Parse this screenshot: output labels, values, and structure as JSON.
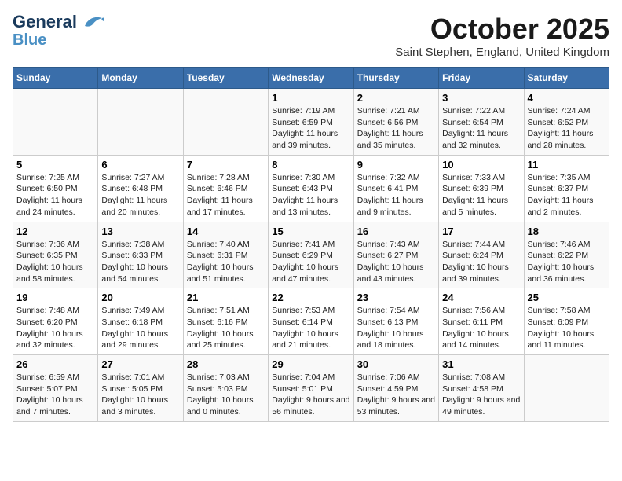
{
  "header": {
    "logo_line1": "General",
    "logo_line2": "Blue",
    "month": "October 2025",
    "location": "Saint Stephen, England, United Kingdom"
  },
  "weekdays": [
    "Sunday",
    "Monday",
    "Tuesday",
    "Wednesday",
    "Thursday",
    "Friday",
    "Saturday"
  ],
  "weeks": [
    [
      {
        "num": "",
        "info": ""
      },
      {
        "num": "",
        "info": ""
      },
      {
        "num": "",
        "info": ""
      },
      {
        "num": "1",
        "info": "Sunrise: 7:19 AM\nSunset: 6:59 PM\nDaylight: 11 hours and 39 minutes."
      },
      {
        "num": "2",
        "info": "Sunrise: 7:21 AM\nSunset: 6:56 PM\nDaylight: 11 hours and 35 minutes."
      },
      {
        "num": "3",
        "info": "Sunrise: 7:22 AM\nSunset: 6:54 PM\nDaylight: 11 hours and 32 minutes."
      },
      {
        "num": "4",
        "info": "Sunrise: 7:24 AM\nSunset: 6:52 PM\nDaylight: 11 hours and 28 minutes."
      }
    ],
    [
      {
        "num": "5",
        "info": "Sunrise: 7:25 AM\nSunset: 6:50 PM\nDaylight: 11 hours and 24 minutes."
      },
      {
        "num": "6",
        "info": "Sunrise: 7:27 AM\nSunset: 6:48 PM\nDaylight: 11 hours and 20 minutes."
      },
      {
        "num": "7",
        "info": "Sunrise: 7:28 AM\nSunset: 6:46 PM\nDaylight: 11 hours and 17 minutes."
      },
      {
        "num": "8",
        "info": "Sunrise: 7:30 AM\nSunset: 6:43 PM\nDaylight: 11 hours and 13 minutes."
      },
      {
        "num": "9",
        "info": "Sunrise: 7:32 AM\nSunset: 6:41 PM\nDaylight: 11 hours and 9 minutes."
      },
      {
        "num": "10",
        "info": "Sunrise: 7:33 AM\nSunset: 6:39 PM\nDaylight: 11 hours and 5 minutes."
      },
      {
        "num": "11",
        "info": "Sunrise: 7:35 AM\nSunset: 6:37 PM\nDaylight: 11 hours and 2 minutes."
      }
    ],
    [
      {
        "num": "12",
        "info": "Sunrise: 7:36 AM\nSunset: 6:35 PM\nDaylight: 10 hours and 58 minutes."
      },
      {
        "num": "13",
        "info": "Sunrise: 7:38 AM\nSunset: 6:33 PM\nDaylight: 10 hours and 54 minutes."
      },
      {
        "num": "14",
        "info": "Sunrise: 7:40 AM\nSunset: 6:31 PM\nDaylight: 10 hours and 51 minutes."
      },
      {
        "num": "15",
        "info": "Sunrise: 7:41 AM\nSunset: 6:29 PM\nDaylight: 10 hours and 47 minutes."
      },
      {
        "num": "16",
        "info": "Sunrise: 7:43 AM\nSunset: 6:27 PM\nDaylight: 10 hours and 43 minutes."
      },
      {
        "num": "17",
        "info": "Sunrise: 7:44 AM\nSunset: 6:24 PM\nDaylight: 10 hours and 39 minutes."
      },
      {
        "num": "18",
        "info": "Sunrise: 7:46 AM\nSunset: 6:22 PM\nDaylight: 10 hours and 36 minutes."
      }
    ],
    [
      {
        "num": "19",
        "info": "Sunrise: 7:48 AM\nSunset: 6:20 PM\nDaylight: 10 hours and 32 minutes."
      },
      {
        "num": "20",
        "info": "Sunrise: 7:49 AM\nSunset: 6:18 PM\nDaylight: 10 hours and 29 minutes."
      },
      {
        "num": "21",
        "info": "Sunrise: 7:51 AM\nSunset: 6:16 PM\nDaylight: 10 hours and 25 minutes."
      },
      {
        "num": "22",
        "info": "Sunrise: 7:53 AM\nSunset: 6:14 PM\nDaylight: 10 hours and 21 minutes."
      },
      {
        "num": "23",
        "info": "Sunrise: 7:54 AM\nSunset: 6:13 PM\nDaylight: 10 hours and 18 minutes."
      },
      {
        "num": "24",
        "info": "Sunrise: 7:56 AM\nSunset: 6:11 PM\nDaylight: 10 hours and 14 minutes."
      },
      {
        "num": "25",
        "info": "Sunrise: 7:58 AM\nSunset: 6:09 PM\nDaylight: 10 hours and 11 minutes."
      }
    ],
    [
      {
        "num": "26",
        "info": "Sunrise: 6:59 AM\nSunset: 5:07 PM\nDaylight: 10 hours and 7 minutes."
      },
      {
        "num": "27",
        "info": "Sunrise: 7:01 AM\nSunset: 5:05 PM\nDaylight: 10 hours and 3 minutes."
      },
      {
        "num": "28",
        "info": "Sunrise: 7:03 AM\nSunset: 5:03 PM\nDaylight: 10 hours and 0 minutes."
      },
      {
        "num": "29",
        "info": "Sunrise: 7:04 AM\nSunset: 5:01 PM\nDaylight: 9 hours and 56 minutes."
      },
      {
        "num": "30",
        "info": "Sunrise: 7:06 AM\nSunset: 4:59 PM\nDaylight: 9 hours and 53 minutes."
      },
      {
        "num": "31",
        "info": "Sunrise: 7:08 AM\nSunset: 4:58 PM\nDaylight: 9 hours and 49 minutes."
      },
      {
        "num": "",
        "info": ""
      }
    ]
  ]
}
